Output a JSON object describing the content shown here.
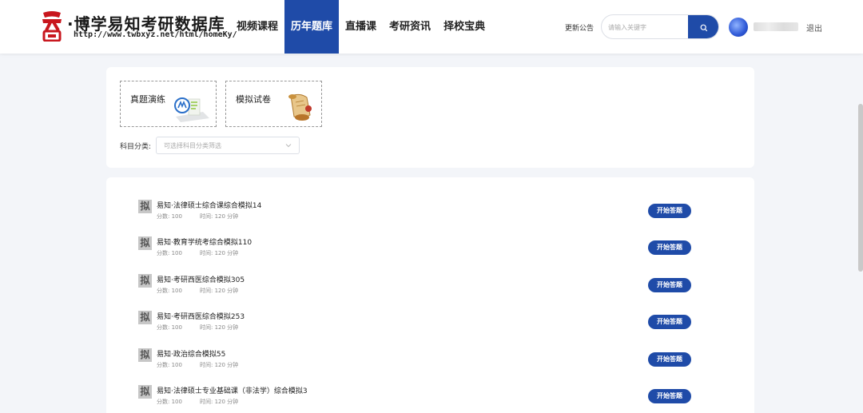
{
  "brand": {
    "title": "博学易知考研数据库",
    "url": "http://www.twbxyz.net/html/homeKy/",
    "logo_chars": "天問"
  },
  "nav": [
    {
      "label": "视频课程",
      "active": false
    },
    {
      "label": "历年题库",
      "active": true
    },
    {
      "label": "直播课",
      "active": false
    },
    {
      "label": "考研资讯",
      "active": false
    },
    {
      "label": "择校宝典",
      "active": false
    }
  ],
  "header": {
    "update_link": "更新公告",
    "search_placeholder": "请输入关键字",
    "search_icon": "search-icon",
    "logout": "退出"
  },
  "filters": {
    "types": [
      {
        "label": "真题演练",
        "icon": "exam-paper-icon"
      },
      {
        "label": "模拟试卷",
        "icon": "scroll-icon"
      }
    ],
    "subject_label": "科目分类:",
    "subject_placeholder": "可选择科目分类筛选"
  },
  "list": {
    "badge": "拟",
    "score_prefix": "分数:",
    "time_prefix": "时间:",
    "button_label": "开始答题",
    "items": [
      {
        "title": "易知·法律硕士综合课综合模拟14",
        "score": "100",
        "time": "120 分钟"
      },
      {
        "title": "易知·教育学统考综合模拟110",
        "score": "100",
        "time": "120 分钟"
      },
      {
        "title": "易知·考研西医综合模拟305",
        "score": "100",
        "time": "120 分钟"
      },
      {
        "title": "易知·考研西医综合模拟253",
        "score": "100",
        "time": "120 分钟"
      },
      {
        "title": "易知·政治综合模拟55",
        "score": "100",
        "time": "120 分钟"
      },
      {
        "title": "易知·法律硕士专业基础课（非法学）综合模拟3",
        "score": "100",
        "time": "120 分钟"
      }
    ]
  },
  "colors": {
    "accent": "#1f4ba8",
    "logo_red": "#c8161d",
    "badge_gray": "#c7c7c7"
  }
}
